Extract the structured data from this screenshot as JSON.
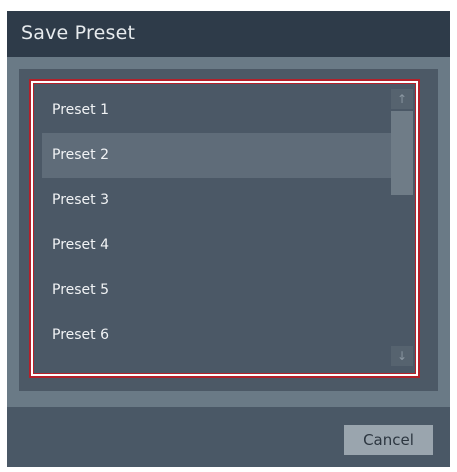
{
  "dialog": {
    "title": "Save Preset"
  },
  "list": {
    "items": [
      {
        "label": "Preset 1"
      },
      {
        "label": "Preset 2"
      },
      {
        "label": "Preset 3"
      },
      {
        "label": "Preset 4"
      },
      {
        "label": "Preset 5"
      },
      {
        "label": "Preset 6"
      }
    ],
    "selected": "Preset 2",
    "scrollbar": {
      "up_icon": "↑",
      "down_icon": "↓"
    }
  },
  "footer": {
    "cancel_label": "Cancel"
  },
  "colors": {
    "titlebar": "#2e3b49",
    "list_background": "#4b5866",
    "selection_outline": "#b4202a",
    "selected_row": "#5f6c79",
    "button": "#9aa5ae"
  }
}
